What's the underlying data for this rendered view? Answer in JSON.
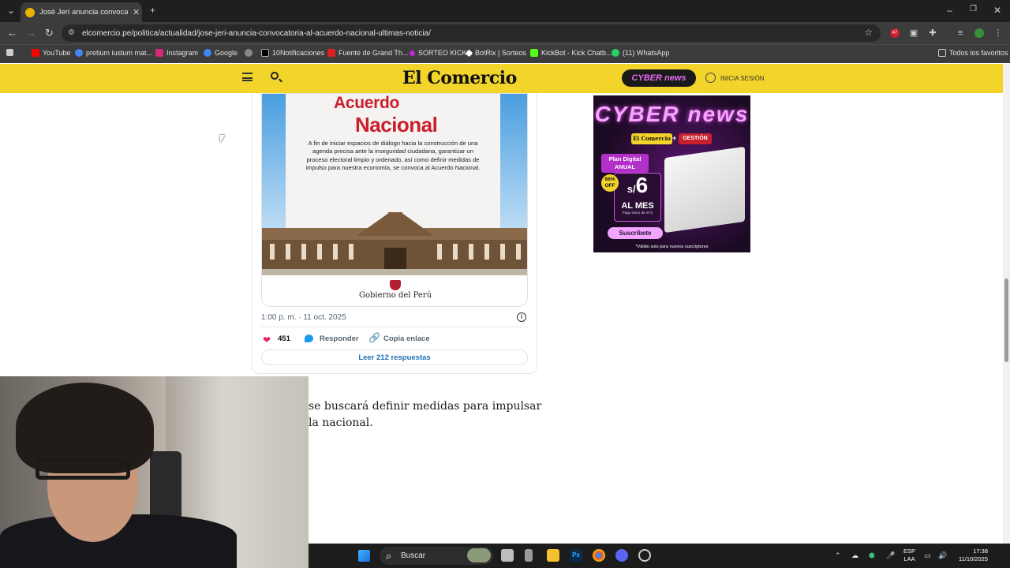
{
  "browser": {
    "tab_title": "José Jerí anuncia convocatoria al",
    "url": "elcomercio.pe/politica/actualidad/jose-jeri-anuncia-convocatoria-al-acuerdo-nacional-ultimas-noticia/",
    "bookmarks": [
      {
        "label": "YouTube",
        "color": "#ff0000"
      },
      {
        "label": "pretium iustum mat...",
        "color": "#4285f4"
      },
      {
        "label": "Instagram",
        "color": "#d62976"
      },
      {
        "label": "Google",
        "color": "#4285f4"
      },
      {
        "label": "",
        "color": "#888888"
      },
      {
        "label": "10Notificaciones",
        "color": "#000000"
      },
      {
        "label": "Fuente de Grand Th...",
        "color": "#e02020"
      },
      {
        "label": "SORTEO KICK",
        "color": "#c026d3"
      },
      {
        "label": "BotRix | Sorteos",
        "color": "#ffffff"
      },
      {
        "label": "KickBot - Kick Chatb...",
        "color": "#53fc18"
      },
      {
        "label": "(11) WhatsApp",
        "color": "#25d366"
      }
    ],
    "all_bookmarks": "Todos los favoritos",
    "extension_badge": "47"
  },
  "site_header": {
    "logo": "El Comercio",
    "cyber_badge": "CYBER news",
    "login": "INICIA SESIÓN"
  },
  "tweet": {
    "image": {
      "title_line1": "Acuerdo",
      "title_line2": "Nacional",
      "body": "A fin de iniciar espacios de diálogo hacia la construcción de una agenda precisa ante la inseguridad ciudadana, garantizar un proceso electoral limpio y ordenado, así como definir medidas de impulso para nuestra economía, se convoca al Acuerdo Nacional.",
      "footer": "Gobierno del Perú"
    },
    "timestamp": "1:00 p. m. · 11 oct. 2025",
    "likes": "451",
    "reply": "Responder",
    "copy_link": "Copia enlace",
    "read_replies": "Leer 212 respuestas"
  },
  "article": {
    "text": "se buscará definir medidas para impulsar la nacional."
  },
  "ad": {
    "headline": "CYBER news",
    "brand1": "El Comercio",
    "plus": "+",
    "brand2": "GESTIÓN",
    "plan": "Plan Digital ANUAL",
    "discount": "66% OFF",
    "price": "6",
    "currency": "s/",
    "period": "AL MES",
    "note": "Pago único de s/72",
    "cta": "Suscríbete",
    "disclaimer": "*Válido solo para nuevos suscriptores"
  },
  "taskbar": {
    "search": "Buscar",
    "lang_line1": "ESP",
    "lang_line2": "LAA",
    "time": "17:38",
    "date": "11/10/2025"
  }
}
